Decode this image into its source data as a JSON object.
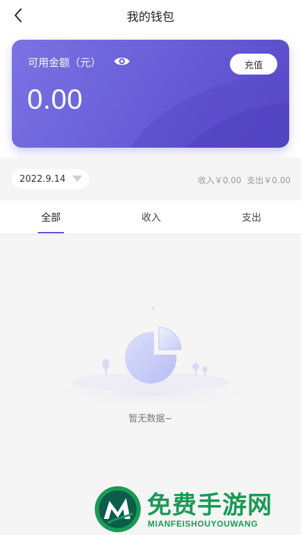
{
  "header": {
    "title": "我的钱包"
  },
  "wallet": {
    "label": "可用金额（元）",
    "balance": "0.00",
    "recharge_label": "充值"
  },
  "filter": {
    "date": "2022.9.14",
    "income_summary": "收入￥0.00",
    "expense_summary": "支出￥0.00"
  },
  "tabs": [
    {
      "label": "全部",
      "active": true
    },
    {
      "label": "收入",
      "active": false
    },
    {
      "label": "支出",
      "active": false
    }
  ],
  "empty_state": {
    "text": "暂无数据~"
  },
  "watermark": {
    "title": "免费手游网",
    "subtitle": "MIANFEISHOUYOUWANG"
  },
  "colors": {
    "card_gradient_start": "#7b72e3",
    "card_gradient_end": "#5847c7",
    "tab_indicator": "#5b4fd0",
    "watermark_green": "#1a9a55"
  }
}
